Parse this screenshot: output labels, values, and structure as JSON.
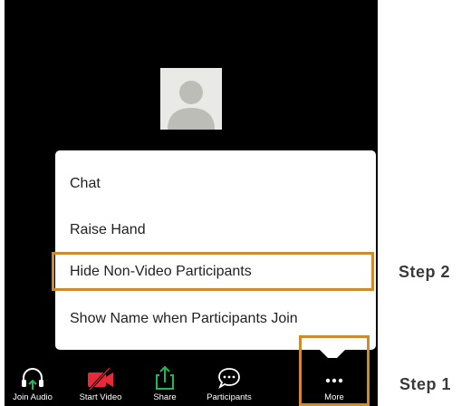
{
  "menu": {
    "items": [
      {
        "label": "Chat"
      },
      {
        "label": "Raise Hand"
      },
      {
        "label": "Hide Non-Video Participants"
      },
      {
        "label": "Show Name when Participants Join"
      }
    ]
  },
  "toolbar": {
    "buttons": [
      {
        "label": "Join Audio",
        "icon": "headphones-icon"
      },
      {
        "label": "Start Video",
        "icon": "video-off-icon"
      },
      {
        "label": "Share",
        "icon": "share-icon"
      },
      {
        "label": "Participants",
        "icon": "chat-bubble-icon"
      },
      {
        "label": "More",
        "icon": "more-icon"
      }
    ]
  },
  "annotations": {
    "step1": "Step 1",
    "step2": "Step 2"
  },
  "colors": {
    "highlight": "#d08a2e",
    "green": "#1db954",
    "red": "#e8293a"
  }
}
